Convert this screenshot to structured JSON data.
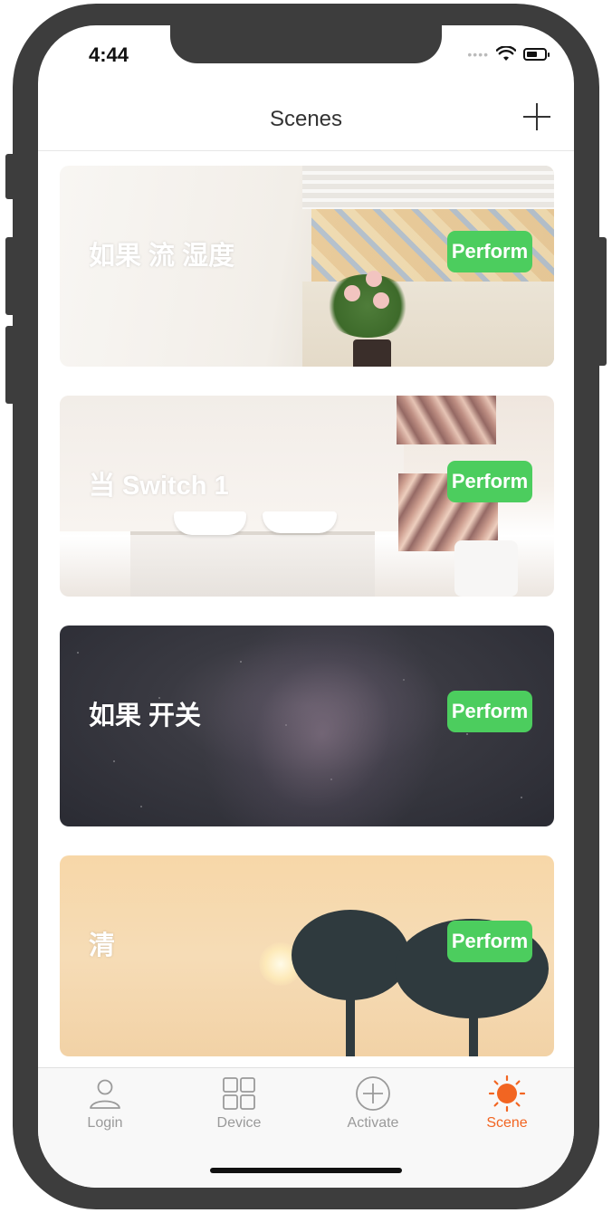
{
  "status_bar": {
    "time": "4:44",
    "signal_icon": "cellular-signal-icon",
    "wifi_icon": "wifi-icon",
    "battery_icon": "battery-icon"
  },
  "nav": {
    "title": "Scenes",
    "add_icon": "plus-icon"
  },
  "scenes": [
    {
      "title": "如果 流 湿度 ",
      "button_label": "Perform",
      "background": "room-window-plant-image"
    },
    {
      "title": "当 Switch 1 ",
      "button_label": "Perform",
      "background": "bathroom-image"
    },
    {
      "title": "如果 开关 ",
      "button_label": "Perform",
      "background": "night-sky-image"
    },
    {
      "title": "清 ",
      "button_label": "Perform",
      "background": "sunset-palm-image"
    }
  ],
  "tabs": [
    {
      "label": "Login",
      "icon": "user-icon",
      "active": false
    },
    {
      "label": "Device",
      "icon": "device-grid-icon",
      "active": false
    },
    {
      "label": "Activate",
      "icon": "plus-circle-icon",
      "active": false
    },
    {
      "label": "Scene",
      "icon": "sun-icon",
      "active": true
    }
  ],
  "colors": {
    "accent": "#f26522",
    "perform_button": "#4ccd5e",
    "tab_inactive": "#9a9a9a"
  }
}
